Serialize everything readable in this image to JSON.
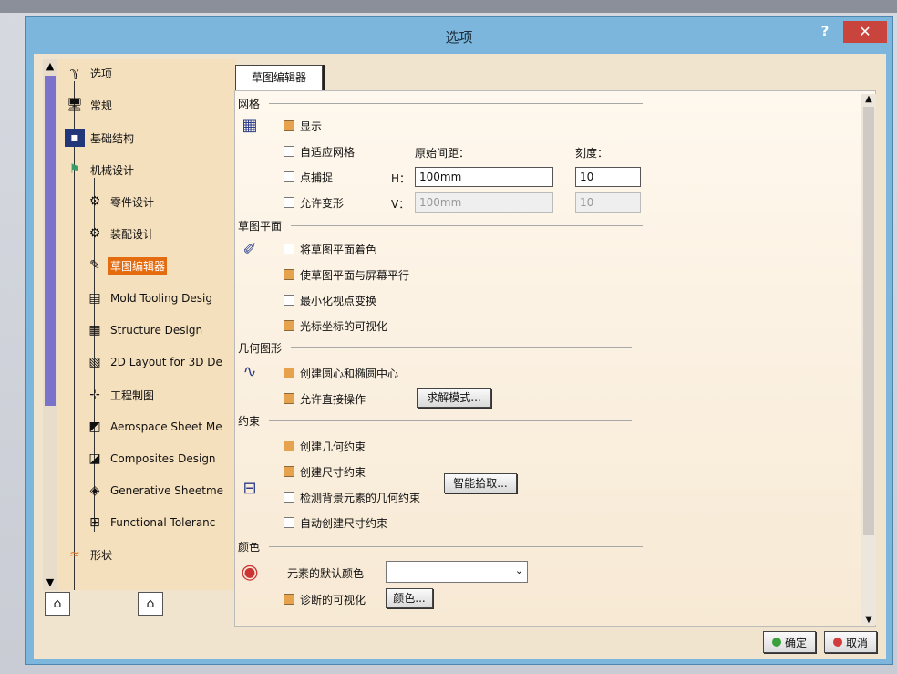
{
  "dialog": {
    "title": "选项",
    "help": "?",
    "close": "✕"
  },
  "tree": {
    "items": [
      {
        "label": "选项",
        "icon": "options-icon"
      },
      {
        "label": "常规",
        "icon": "monitor-icon"
      },
      {
        "label": "基础结构",
        "icon": "infrastructure-icon"
      },
      {
        "label": "机械设计",
        "icon": "mechanical-design-icon"
      },
      {
        "label": "零件设计",
        "icon": "part-design-icon"
      },
      {
        "label": "装配设计",
        "icon": "assembly-design-icon"
      },
      {
        "label": "草图编辑器",
        "icon": "sketcher-icon",
        "selected": true
      },
      {
        "label": "Mold Tooling Desig",
        "icon": "mold-tooling-icon"
      },
      {
        "label": "Structure Design",
        "icon": "structure-design-icon"
      },
      {
        "label": "2D Layout for 3D De",
        "icon": "layout-2d-icon"
      },
      {
        "label": "工程制图",
        "icon": "drafting-icon"
      },
      {
        "label": "Aerospace Sheet Me",
        "icon": "aerospace-sheet-icon"
      },
      {
        "label": "Composites Design",
        "icon": "composites-icon"
      },
      {
        "label": "Generative Sheetme",
        "icon": "generative-sheetmetal-icon"
      },
      {
        "label": "Functional Toleranc",
        "icon": "functional-tolerancing-icon"
      },
      {
        "label": "形状",
        "icon": "shape-icon"
      }
    ]
  },
  "tab": {
    "label": "草图编辑器"
  },
  "grid": {
    "title": "网格",
    "show": {
      "label": "显示",
      "checked": true
    },
    "adaptive": {
      "label": "自适应网格",
      "checked": false
    },
    "snap": {
      "label": "点捕捉",
      "checked": false
    },
    "distort": {
      "label": "允许变形",
      "checked": false
    },
    "spacing_label": "原始间距：",
    "graduation_label": "刻度：",
    "h_label": "H：",
    "v_label": "V：",
    "h_value": "100mm",
    "v_value": "100mm",
    "h_grad": "10",
    "v_grad": "10"
  },
  "sketch_plane": {
    "title": "草图平面",
    "shade": {
      "label": "将草图平面着色",
      "checked": false
    },
    "parallel": {
      "label": "使草图平面与屏幕平行",
      "checked": true
    },
    "minimize": {
      "label": "最小化视点变换",
      "checked": false
    },
    "cursor": {
      "label": "光标坐标的可视化",
      "checked": true
    }
  },
  "geometry": {
    "title": "几何图形",
    "centers": {
      "label": "创建圆心和椭圆中心",
      "checked": true
    },
    "direct": {
      "label": "允许直接操作",
      "checked": true
    },
    "solve_button": "求解模式..."
  },
  "constraint": {
    "title": "约束",
    "geometric": {
      "label": "创建几何约束",
      "checked": true
    },
    "dimensional": {
      "label": "创建尺寸约束",
      "checked": true
    },
    "background": {
      "label": "检测背景元素的几何约束",
      "checked": false
    },
    "auto": {
      "label": "自动创建尺寸约束",
      "checked": false
    },
    "smart_button": "智能拾取..."
  },
  "colors": {
    "title": "颜色",
    "default_label": "元素的默认颜色",
    "default_value": "",
    "diagnosis": {
      "label": "诊断的可视化",
      "checked": true
    },
    "color_button": "颜色..."
  },
  "footer": {
    "ok": "确定",
    "cancel": "取消"
  }
}
